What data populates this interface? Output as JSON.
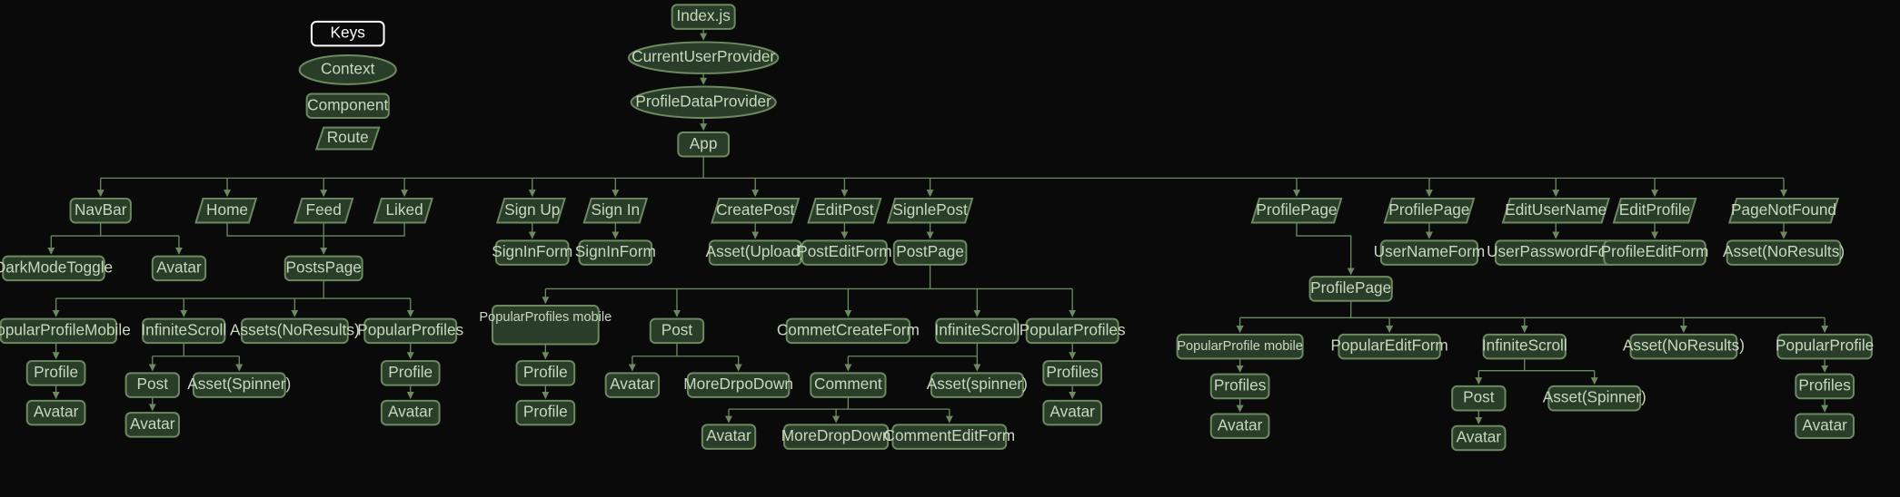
{
  "legend": {
    "keys": "Keys",
    "context": "Context",
    "component": "Component",
    "route": "Route"
  },
  "nodes": {
    "index": "Index.js",
    "cup": "CurrentUserProvider",
    "pdp": "ProfileDataProvider",
    "app": "App",
    "navbar": "NavBar",
    "home": "Home",
    "feed": "Feed",
    "liked": "Liked",
    "signup": "Sign Up",
    "signin": "Sign In",
    "createpost": "CreatePost",
    "editpost": "EditPost",
    "singlepost": "SignlePost",
    "profilepage1": "ProfilePage",
    "profilepage2": "ProfilePage",
    "editusername": "EditUserName",
    "editprofile": "EditProfile",
    "pagenotfound": "PageNotFound",
    "darkmode": "DarkModeToggle",
    "avatar1": "Avatar",
    "postspage": "PostsPage",
    "signinform1": "SignInForm",
    "signinform2": "SignInForm",
    "assetupload": "Asset(Upload)",
    "posteditform": "PostEditForm",
    "postpage": "PostPage",
    "usernameform": "UserNameForm",
    "userpasswordform": "UserPasswordForm",
    "profileeditform": "ProfileEditForm",
    "assetnoresults1": "Asset(NoResults)",
    "popularprofilemobile": "PopularProfileMobile",
    "infinitescroll1": "InfiniteScroll",
    "assetnoresults2": "Assets(NoResults)",
    "popularprofiles1": "PopularProfiles",
    "profile1": "Profile",
    "avatar2": "Avatar",
    "post1": "Post",
    "assetspinner1": "Asset(Spinner)",
    "avatar3": "Avatar",
    "profile2": "Profile",
    "avatar4": "Avatar",
    "popularprofilesmobile2": "PopularProfiles mobile",
    "profile3": "Profile",
    "profile4": "Profile",
    "post2": "Post",
    "avatar5": "Avatar",
    "moredropdown1": "MoreDrpoDown",
    "commentcreateform": "CommetCreateForm",
    "infinitescroll2": "InfiniteScroll",
    "popularprofiles2": "PopularProfiles",
    "comment": "Comment",
    "assetspinner2": "Asset(spinner)",
    "profiles1": "Profiles",
    "avatar6": "Avatar",
    "avatar7": "Avatar",
    "moredropdown2": "MoreDropDown",
    "commenteditform": "CommentEditForm",
    "profilepage3": "ProfilePage",
    "popularprofilemobile3": "PopularProfile mobile",
    "populareditform": "PopularEditForm",
    "infinitescroll3": "InfiniteScroll",
    "assetnoresults3": "Asset(NoResults)",
    "popularprofile3": "PopularProfile",
    "profiles2": "Profiles",
    "avatar8": "Avatar",
    "post3": "Post",
    "assetspinner3": "Asset(Spinner)",
    "avatar9": "Avatar",
    "profiles3": "Profiles",
    "avatar10": "Avatar"
  }
}
